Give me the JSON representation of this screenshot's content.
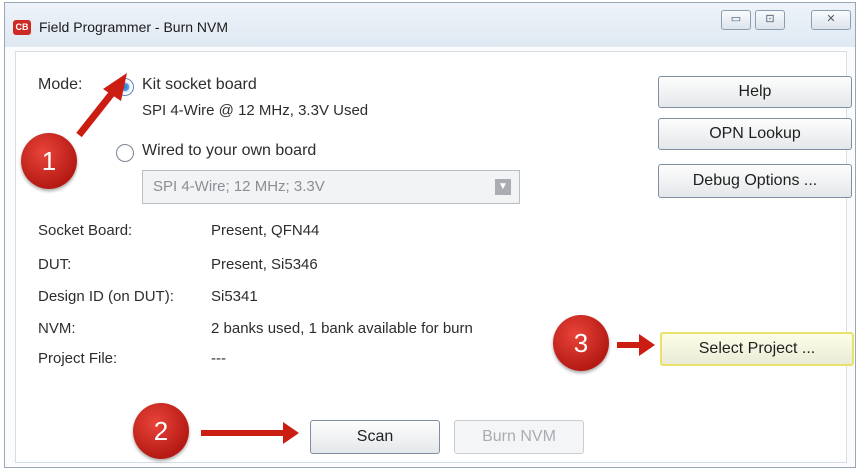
{
  "window": {
    "title": "Field Programmer - Burn NVM",
    "app_icon": "CB"
  },
  "title_controls": {
    "minimize": "▭",
    "maximize": "⊡",
    "close": "✕"
  },
  "mode": {
    "label": "Mode:",
    "option1": {
      "label": "Kit socket board",
      "detail": "SPI 4-Wire @ 12 MHz, 3.3V Used",
      "selected": true
    },
    "option2": {
      "label": "Wired to your own board",
      "selected": false,
      "select_value": "SPI 4-Wire; 12 MHz; 3.3V"
    }
  },
  "buttons": {
    "help": "Help",
    "opn_lookup": "OPN Lookup",
    "debug_options": "Debug Options ...",
    "select_project": "Select Project ...",
    "scan": "Scan",
    "burn_nvm": "Burn NVM"
  },
  "info": [
    {
      "label": "Socket Board:",
      "value": "Present, QFN44"
    },
    {
      "label": "DUT:",
      "value": "Present, Si5346"
    },
    {
      "label": "Design ID (on DUT):",
      "value": "Si5341"
    },
    {
      "label": "NVM:",
      "value": "2 banks used, 1 bank available for burn"
    },
    {
      "label": "Project File:",
      "value": "---"
    }
  ],
  "callouts": {
    "one": "1",
    "two": "2",
    "three": "3"
  },
  "colors": {
    "callout": "#cc1d13",
    "accent": "#2f78c8",
    "highlight_border": "#e7e26a"
  }
}
